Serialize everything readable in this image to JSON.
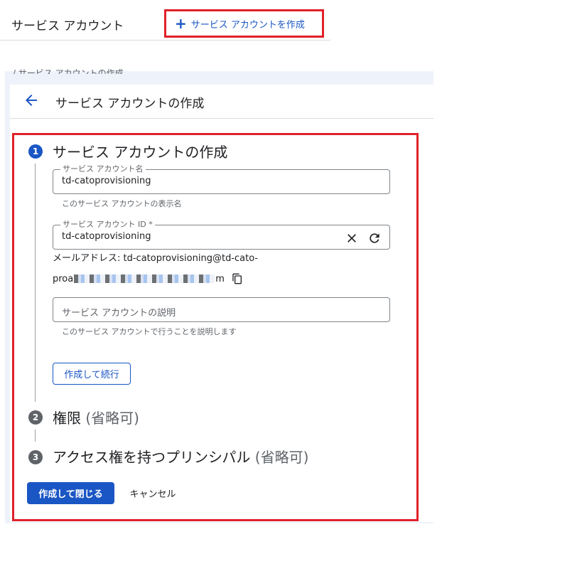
{
  "header": {
    "title": "サービス アカウント",
    "create_link_label": "サービス アカウントを作成",
    "create_link_icon": "plus-icon"
  },
  "breadcrumb_peek": "/ サービス アカウントの作成",
  "page": {
    "back_icon": "arrow-left-icon",
    "title": "サービス アカウントの作成"
  },
  "steps": [
    {
      "number": "1",
      "title": "サービス アカウントの作成",
      "optional": ""
    },
    {
      "number": "2",
      "title": "権限",
      "optional": "(省略可)"
    },
    {
      "number": "3",
      "title": "アクセス権を持つプリンシパル",
      "optional": "(省略可)"
    }
  ],
  "form": {
    "name_label": "サービス アカウント名",
    "name_value": "td-catoprovisioning",
    "name_hint": "このサービス アカウントの表示名",
    "id_label": "サービス アカウント ID *",
    "id_value": "td-catoprovisioning",
    "email_line1": "メールアドレス: td-catoprovisioning@td-cato-",
    "email_prefix": "proa",
    "email_suffix": "m",
    "description_placeholder": "サービス アカウントの説明",
    "description_hint": "このサービス アカウントで行うことを説明します",
    "create_continue_label": "作成して続行"
  },
  "actions": {
    "create_close_label": "作成して閉じる",
    "cancel_label": "キャンセル"
  },
  "colors": {
    "accent": "#1a56c4",
    "highlight_border": "#e0202a",
    "panel_bg": "#eef3fb"
  }
}
